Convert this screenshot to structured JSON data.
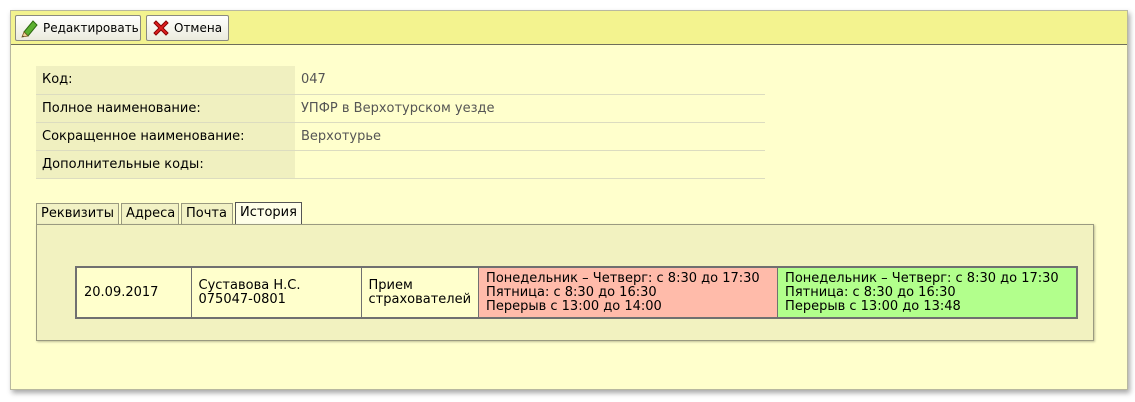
{
  "toolbar": {
    "edit_label": "Редактировать",
    "cancel_label": "Отмена"
  },
  "properties": [
    {
      "label": "Код:",
      "value": "047"
    },
    {
      "label": "Полное наименование:",
      "value": "УПФР в Верхотурском уезде"
    },
    {
      "label": "Сокращенное наименование:",
      "value": "Верхотурье"
    },
    {
      "label": "Дополнительные коды:",
      "value": ""
    }
  ],
  "tabs": [
    "Реквизиты",
    "Адреса",
    "Почта",
    "История"
  ],
  "active_tab": "История",
  "history": {
    "rows": [
      {
        "date": "20.09.2017",
        "user_name": "Суставова Н.С.",
        "user_code": "075047-0801",
        "type_line1": "Прием",
        "type_line2": "страхователей",
        "old_lines": [
          "Понедельник – Четверг: с 8:30 до 17:30",
          "Пятница: с 8:30 до 16:30",
          "Перерыв с 13:00 до 14:00"
        ],
        "new_lines": [
          "Понедельник – Четверг: с 8:30 до 17:30",
          "Пятница: с 8:30 до 16:30",
          "Перерыв с 13:00 до 13:48"
        ]
      }
    ]
  },
  "colors": {
    "toolbar_bg": "#f3f38f",
    "page_bg": "#ffffcc",
    "old_value_bg": "#ffbbaa",
    "new_value_bg": "#b2ff8c"
  },
  "icons": {
    "edit": "pencil-icon",
    "cancel": "red-x-icon"
  }
}
